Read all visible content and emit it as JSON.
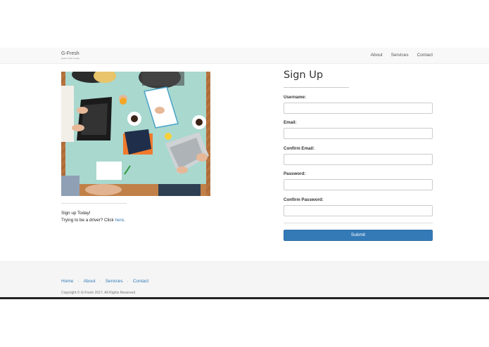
{
  "brand": {
    "title": "G-Fresh",
    "subtitle": "Quick, fresh & easy"
  },
  "nav": {
    "items": [
      "About",
      "Services",
      "Contact"
    ]
  },
  "signup_text": {
    "line1": "Sign up Today!",
    "line2_prefix": "Trying to be a driver? Click ",
    "link": "here",
    "line2_suffix": "."
  },
  "form": {
    "title": "Sign Up",
    "fields": [
      {
        "label": "Username:",
        "value": ""
      },
      {
        "label": "Email:",
        "value": ""
      },
      {
        "label": "Confirm Email:",
        "value": ""
      },
      {
        "label": "Password:",
        "value": ""
      },
      {
        "label": "Confirm Password:",
        "value": ""
      }
    ],
    "submit_label": "Submit"
  },
  "footer": {
    "links": [
      "Home",
      "About",
      "Services",
      "Contact"
    ],
    "separator": "·",
    "copyright": "Copyright © G-Fresh 2017. All Rights Reserved"
  },
  "colors": {
    "accent": "#337ab7",
    "navbar_bg": "#f8f8f8",
    "footer_bg": "#f5f5f5",
    "table_top": "#a9d8cf"
  },
  "image": {
    "subject": "team-working-at-table-icon"
  }
}
